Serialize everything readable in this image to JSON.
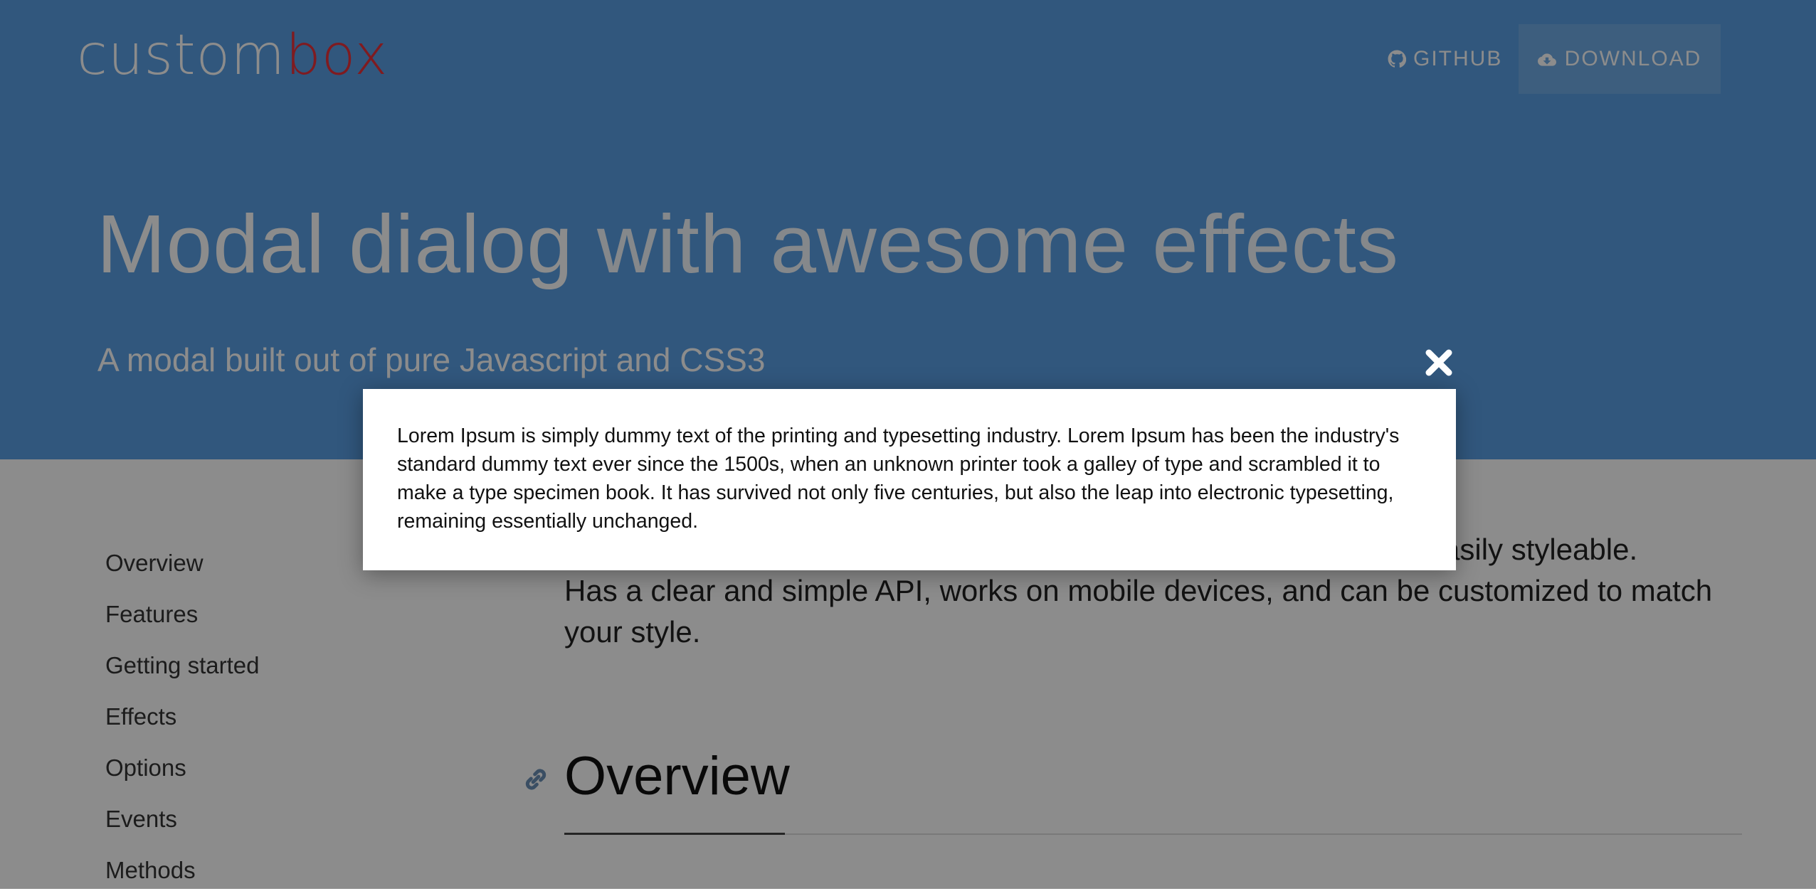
{
  "header": {
    "logo_part_a": "custom",
    "logo_part_b": "box",
    "nav": {
      "github_label": "GITHUB",
      "download_label": "DOWNLOAD"
    }
  },
  "hero": {
    "title_main": "Modal dialog",
    "title_light": "with awesome effects",
    "subtitle": "A modal built out of pure Javascript and CSS3"
  },
  "sidebar": {
    "items": [
      {
        "label": "Overview"
      },
      {
        "label": "Features"
      },
      {
        "label": "Getting started"
      },
      {
        "label": "Effects"
      },
      {
        "label": "Options"
      },
      {
        "label": "Events"
      },
      {
        "label": "Methods"
      }
    ]
  },
  "main": {
    "intro_tail": "asily styleable.",
    "intro_rest": "Has a clear and simple API, works on mobile devices, and can be customized to match your style.",
    "section_title": "Overview"
  },
  "modal": {
    "text": "Lorem Ipsum is simply dummy text of the printing and typesetting industry. Lorem Ipsum has been the industry's standard dummy text ever since the 1500s, when an unknown printer took a galley of type and scrambled it to make a type specimen book. It has survived not only five centuries, but also the leap into electronic typesetting, remaining essentially unchanged."
  },
  "icons": {
    "github": "github-icon",
    "download": "cloud-download-icon",
    "anchor": "link-icon",
    "close": "close-icon"
  },
  "colors": {
    "hero_bg": "#5a9fe3",
    "logo_accent": "#e8323b",
    "overlay": "rgba(0,0,0,0.45)"
  }
}
